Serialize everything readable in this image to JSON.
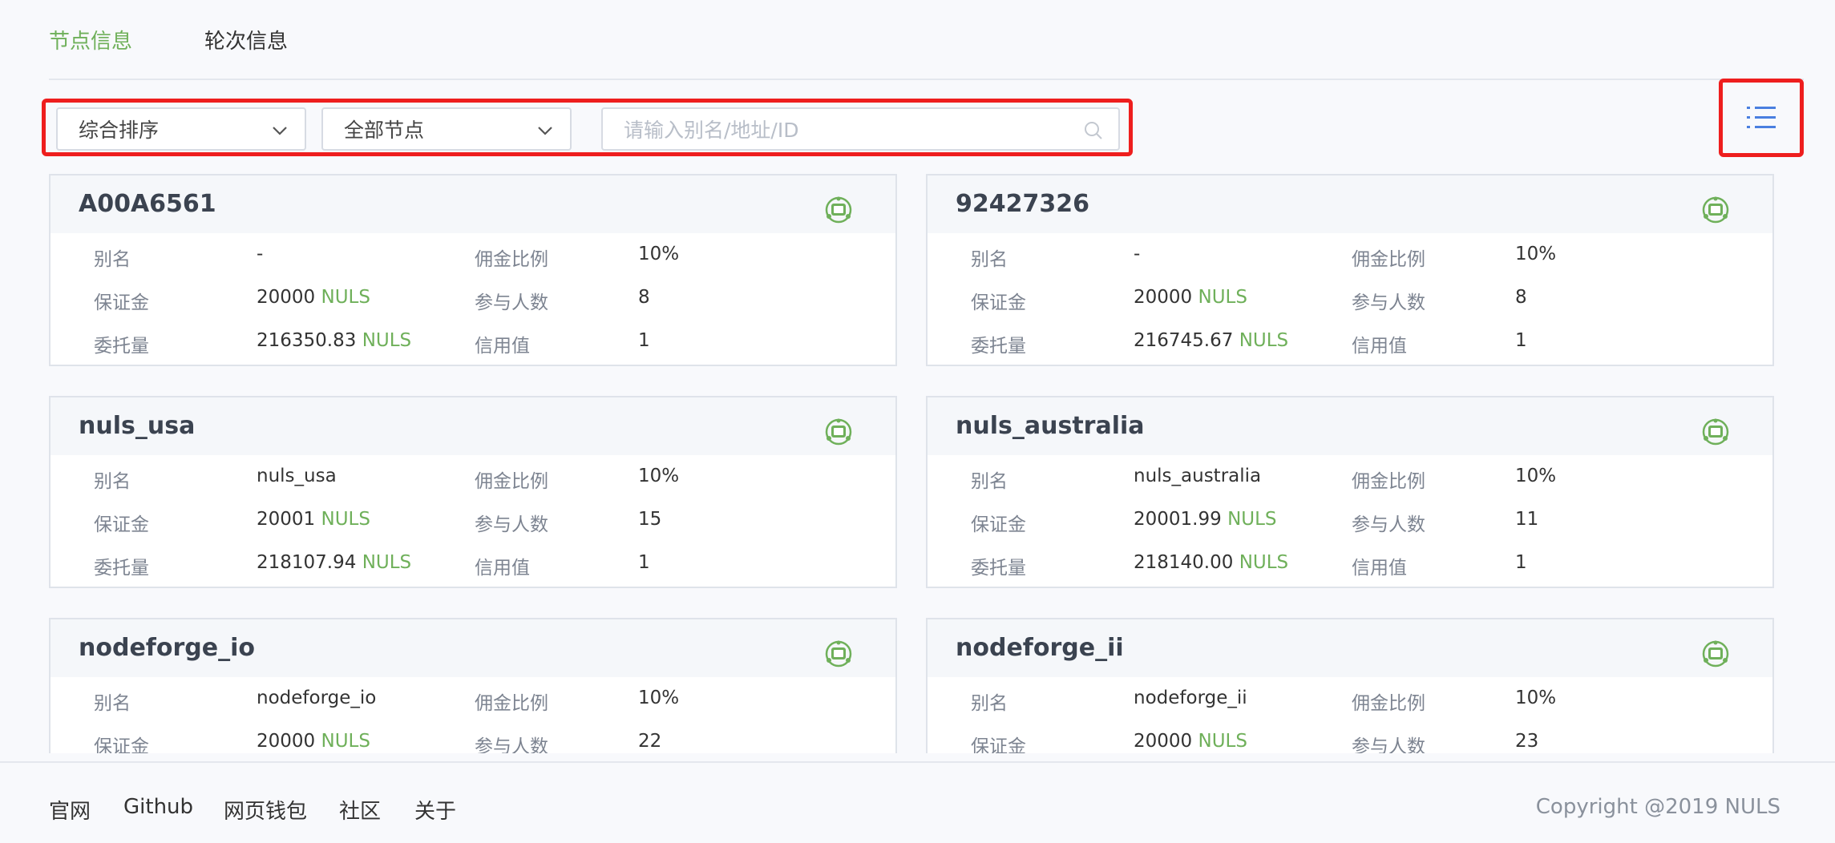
{
  "tabs": [
    {
      "label": "节点信息",
      "active": true
    },
    {
      "label": "轮次信息",
      "active": false
    }
  ],
  "filters": {
    "sort_value": "综合排序",
    "node_type_value": "全部节点",
    "search_placeholder": "请输入别名/地址/ID"
  },
  "labels": {
    "alias": "别名",
    "deposit": "保证金",
    "delegated": "委托量",
    "commission": "佣金比例",
    "participants": "参与人数",
    "credit": "信用值",
    "unit": "NULS"
  },
  "nodes": [
    {
      "id": "A00A6561",
      "alias": "-",
      "deposit": "20000",
      "delegated": "216350.83",
      "commission": "10%",
      "participants": "8",
      "credit": "1"
    },
    {
      "id": "92427326",
      "alias": "-",
      "deposit": "20000",
      "delegated": "216745.67",
      "commission": "10%",
      "participants": "8",
      "credit": "1"
    },
    {
      "id": "nuls_usa",
      "alias": "nuls_usa",
      "deposit": "20001",
      "delegated": "218107.94",
      "commission": "10%",
      "participants": "15",
      "credit": "1"
    },
    {
      "id": "nuls_australia",
      "alias": "nuls_australia",
      "deposit": "20001.99",
      "delegated": "218140.00",
      "commission": "10%",
      "participants": "11",
      "credit": "1"
    },
    {
      "id": "nodeforge_io",
      "alias": "nodeforge_io",
      "deposit": "20000",
      "delegated": "",
      "commission": "10%",
      "participants": "22",
      "credit": ""
    },
    {
      "id": "nodeforge_ii",
      "alias": "nodeforge_ii",
      "deposit": "20000",
      "delegated": "",
      "commission": "10%",
      "participants": "23",
      "credit": ""
    }
  ],
  "footer": {
    "links": [
      "官网",
      "Github",
      "网页钱包",
      "社区",
      "关于"
    ],
    "copyright": "Copyright @2019 NULS"
  },
  "colors": {
    "accent_green": "#6fb05a",
    "highlight_red": "#ee1e1e",
    "icon_blue": "#4a7fe0"
  },
  "icons": {
    "node_status": "robot-icon",
    "view_toggle": "list-view-icon",
    "search": "search-icon",
    "dropdown": "chevron-down-icon"
  }
}
